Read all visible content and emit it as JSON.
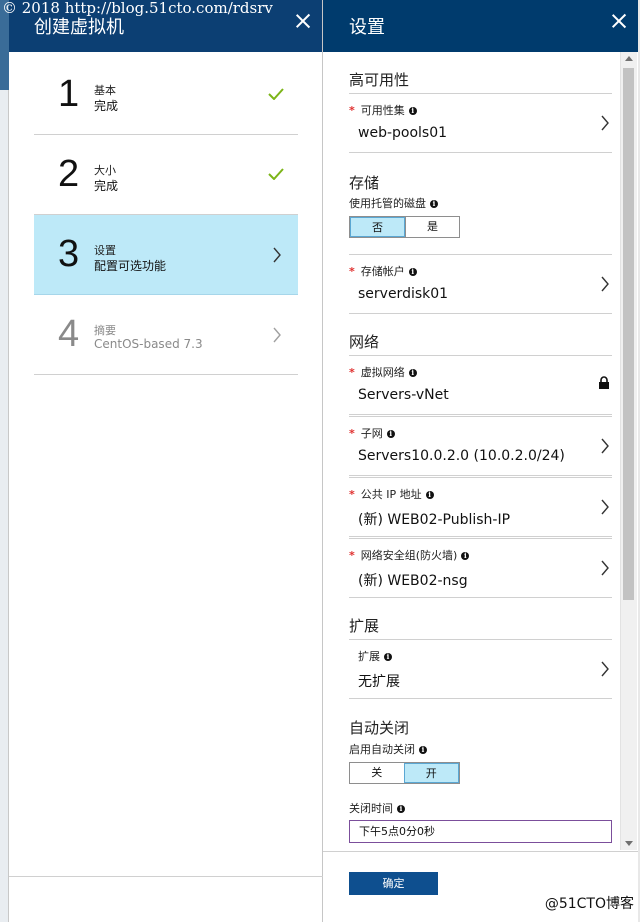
{
  "watermark_top": "© 2018 http://blog.51cto.com/rdsrv",
  "watermark_bottom": "@51CTO博客",
  "left_blade": {
    "title": "创建虚拟机",
    "steps": [
      {
        "number": "1",
        "title": "基本",
        "subtitle": "完成",
        "state": "done"
      },
      {
        "number": "2",
        "title": "大小",
        "subtitle": "完成",
        "state": "done"
      },
      {
        "number": "3",
        "title": "设置",
        "subtitle": "配置可选功能",
        "state": "active"
      },
      {
        "number": "4",
        "title": "摘要",
        "subtitle": "CentOS-based 7.3",
        "state": "disabled"
      }
    ]
  },
  "right_blade": {
    "title": "设置",
    "sections": {
      "availability": "高可用性",
      "storage": "存储",
      "network": "网络",
      "extensions": "扩展",
      "auto_shutdown": "自动关闭"
    },
    "availability_set": {
      "label": "可用性集",
      "value": "web-pools01"
    },
    "managed_disk": {
      "label": "使用托管的磁盘",
      "options": [
        "否",
        "是"
      ],
      "selected": "否"
    },
    "storage_account": {
      "label": "存储帐户",
      "value": "serverdisk01"
    },
    "virtual_network": {
      "label": "虚拟网络",
      "value": "Servers-vNet"
    },
    "subnet": {
      "label": "子网",
      "value": "Servers10.0.2.0 (10.0.2.0/24)"
    },
    "public_ip": {
      "label": "公共 IP 地址",
      "value": "(新) WEB02-Publish-IP"
    },
    "nsg": {
      "label": "网络安全组(防火墙)",
      "value": "(新) WEB02-nsg"
    },
    "extensions_row": {
      "label": "扩展",
      "value": "无扩展"
    },
    "auto_shutdown_toggle": {
      "label": "启用自动关闭",
      "options": [
        "关",
        "开"
      ],
      "selected": "开"
    },
    "shutdown_time": {
      "label": "关闭时间",
      "value": "下午5点0分0秒"
    },
    "ok_button": "确定",
    "required_mark": "*",
    "info_glyph": "i"
  },
  "colors": {
    "header_bg": "#003b6d",
    "active_step_bg": "#bde9f8",
    "check_green": "#7cb518",
    "required_red": "#e0302f",
    "button_blue": "#0e4f8f"
  }
}
